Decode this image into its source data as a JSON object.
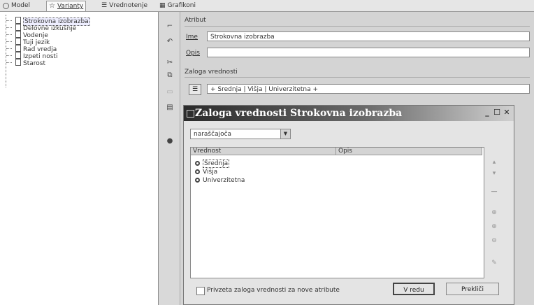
{
  "tabs": [
    {
      "label": "Model",
      "icon": "model-icon"
    },
    {
      "label": "Varianty",
      "icon": "star-icon"
    },
    {
      "label": "Vrednotenje",
      "icon": "list-icon"
    },
    {
      "label": "Grafikoni",
      "icon": "chart-icon"
    }
  ],
  "tree": {
    "items": [
      "Strokovna izobrazba",
      "Delovne izkušnje",
      "Vodenje",
      "Tuji jezik",
      "Rad vredja",
      "Izpeti nosti",
      "Starost"
    ]
  },
  "toolbar_icons": [
    "new-icon",
    "undo-icon",
    "cut-icon",
    "copy-icon",
    "paste-icon",
    "delete-icon",
    "tag-icon"
  ],
  "attribute": {
    "group_title": "Atribut",
    "name_label": "Ime",
    "name_value": "Strokovna izobrazba",
    "desc_label": "Opis",
    "desc_value": ""
  },
  "value_scale": {
    "group_title": "Zaloga vrednosti",
    "value": "+ Srednja | Višja | Univerzitetna +"
  },
  "dialog": {
    "title": "Zaloga vrednosti Strokovna izobrazba",
    "combo_value": "naraščajoča",
    "col_value": "Vrednost",
    "col_desc": "Opis",
    "rows": [
      "Srednja",
      "Višja",
      "Univerzitetna"
    ],
    "checkbox_label": "Privzeta zaloga vrednosti za nove atribute",
    "ok_label": "V redu",
    "cancel_label": "Prekliči",
    "min_label": "_",
    "max_label": "☐",
    "close_label": "✕"
  }
}
